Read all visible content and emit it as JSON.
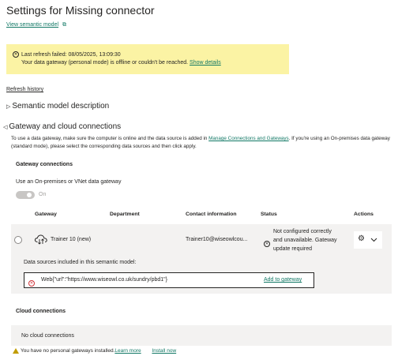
{
  "page": {
    "title": "Settings for Missing connector",
    "view_link": "View semantic model"
  },
  "alert": {
    "line1": "Last refresh failed: 08/05/2025, 13:09:30",
    "line2": "Your data gateway (personal mode) is offline or couldn't be reached.",
    "details_link": "Show details"
  },
  "refresh_history": "Refresh history",
  "sections": {
    "description": "Semantic model description",
    "gateway": "Gateway and cloud connections"
  },
  "gateway_intro": {
    "part1": "To use a data gateway, make sure the computer is online and the data source is added in ",
    "link": "Manage Connections and Gateways",
    "part2": ". If you're using an On-premises data gateway (standard mode), please select the corresponding data sources and then click apply."
  },
  "gateway_connections": {
    "heading": "Gateway connections",
    "toggle_label": "Use an On-premises or VNet data gateway",
    "toggle_state": "On",
    "columns": [
      "Gateway",
      "Department",
      "Contact information",
      "Status",
      "Actions"
    ],
    "row": {
      "gateway": "Trainer 10 (new)",
      "department": "",
      "contact": "Trainer10@wiseowlcou...",
      "status_line1": "Not configured correctly",
      "status_line2": "and unavailable. Gateway",
      "status_line3": "update required"
    },
    "datasources_label": "Data sources included in this semantic model:",
    "datasource": "Web{\"url\":\"https://www.wiseowl.co.uk/sundry/pbd1\"}",
    "add_link": "Add to gateway"
  },
  "cloud_connections": {
    "heading": "Cloud connections",
    "empty": "No cloud connections"
  },
  "footer": {
    "message": "You have no personal gateways installed.",
    "learn_more": "Learn more",
    "install": "Install now"
  },
  "colors": {
    "accent_link": "#117865",
    "warning_bg": "#fbf3a4",
    "error_red": "#d13438",
    "row_bg": "#f3f2f1"
  }
}
